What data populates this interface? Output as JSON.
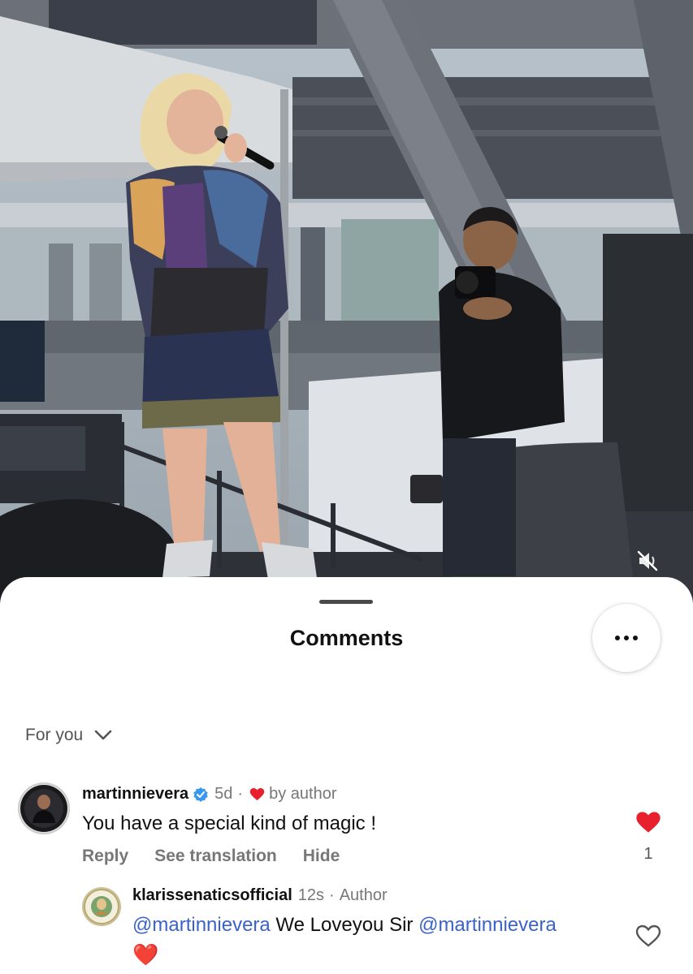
{
  "sheet": {
    "title": "Comments",
    "sort_label": "For you"
  },
  "comments": [
    {
      "username": "martinnievera",
      "verified": true,
      "time": "5d",
      "separator": "·",
      "liked_by_author": "by author",
      "text": "You have a special kind of magic !",
      "actions": [
        "Reply",
        "See translation",
        "Hide"
      ],
      "likes": "1",
      "liked": true,
      "replies": [
        {
          "username": "klarissenaticsofficial",
          "time": "12s",
          "separator": "·",
          "badge": "Author",
          "mention1": "@martinnievera",
          "middle": " We Loveyou Sir ",
          "mention2": "@martinnievera",
          "emoji": "❤️",
          "liked": false
        }
      ]
    }
  ],
  "colors": {
    "like_red": "#e8202e",
    "mention_blue": "#3a63c9",
    "verified_blue": "#3897f0"
  },
  "icons": [
    "mute-icon",
    "more-icon",
    "chevron-down-icon",
    "verified-icon",
    "heart-icon"
  ]
}
